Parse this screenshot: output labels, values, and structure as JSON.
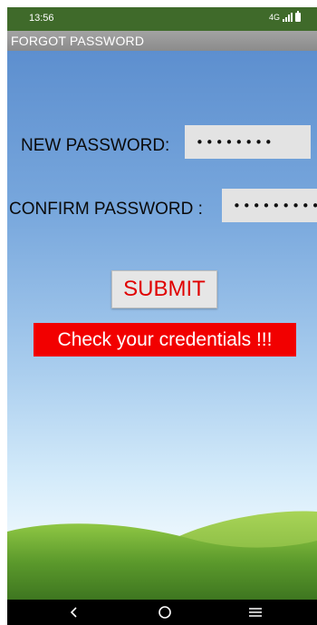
{
  "status_bar": {
    "time": "13:56",
    "network": "4G"
  },
  "app": {
    "title": "FORGOT PASSWORD"
  },
  "form": {
    "new_password_label": "NEW PASSWORD:",
    "new_password_value": "••••••••",
    "confirm_password_label": "CONFIRM PASSWORD :",
    "confirm_password_value": "•••••••••",
    "submit_label": "SUBMIT"
  },
  "message": {
    "error_text": "Check your credentials !!!"
  },
  "nav_bar": {
    "back_icon": "back-chevron-icon",
    "home_icon": "home-circle-icon",
    "menu_icon": "menu-lines-icon"
  },
  "colors": {
    "error_background": "#f20000",
    "submit_text": "#e00000",
    "status_bar": "#3f6a2a"
  }
}
